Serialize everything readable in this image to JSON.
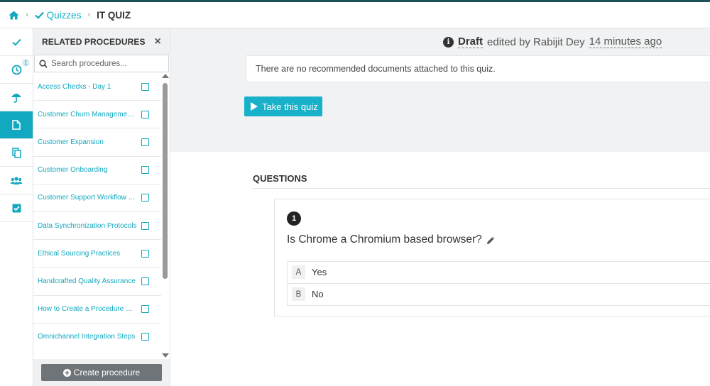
{
  "breadcrumb": {
    "home_icon": "home-icon",
    "quizzes_label": "Quizzes",
    "current_label": "IT QUIZ"
  },
  "rail": {
    "items": [
      {
        "icon": "check-icon"
      },
      {
        "icon": "clock-icon",
        "badge": "1"
      },
      {
        "icon": "umbrella-icon"
      },
      {
        "icon": "document-icon",
        "active": true
      },
      {
        "icon": "copy-icon"
      },
      {
        "icon": "users-icon"
      },
      {
        "icon": "checkbox-icon"
      }
    ]
  },
  "panel": {
    "title": "RELATED PROCEDURES",
    "close_label": "×",
    "search_placeholder": "Search procedures...",
    "items": [
      {
        "label": "Access Checks - Day 1"
      },
      {
        "label": "Customer Churn Management Strategies"
      },
      {
        "label": "Customer Expansion"
      },
      {
        "label": "Customer Onboarding"
      },
      {
        "label": "Customer Support Workflow for Escalations"
      },
      {
        "label": "Data Synchronization Protocols"
      },
      {
        "label": "Ethical Sourcing Practices"
      },
      {
        "label": "Handcrafted Quality Assurance"
      },
      {
        "label": "How to Create a Procedure Using Templates"
      },
      {
        "label": "Omnichannel Integration Steps"
      }
    ],
    "create_label": "Create procedure"
  },
  "status": {
    "draft_label": "Draft",
    "edited_by": "edited by Rabijit Dey",
    "time_ago": "14 minutes ago"
  },
  "main": {
    "no_docs_text": "There are no recommended documents attached to this quiz.",
    "take_quiz_label": "Take this quiz",
    "questions_title": "QUESTIONS",
    "question": {
      "number": "1",
      "text": "Is Chrome a Chromium based browser?",
      "options": [
        {
          "letter": "A",
          "text": "Yes"
        },
        {
          "letter": "B",
          "text": "No"
        }
      ]
    }
  },
  "colors": {
    "accent": "#12a8bf",
    "top_line": "#1e5058",
    "create_button": "#6f7479"
  }
}
